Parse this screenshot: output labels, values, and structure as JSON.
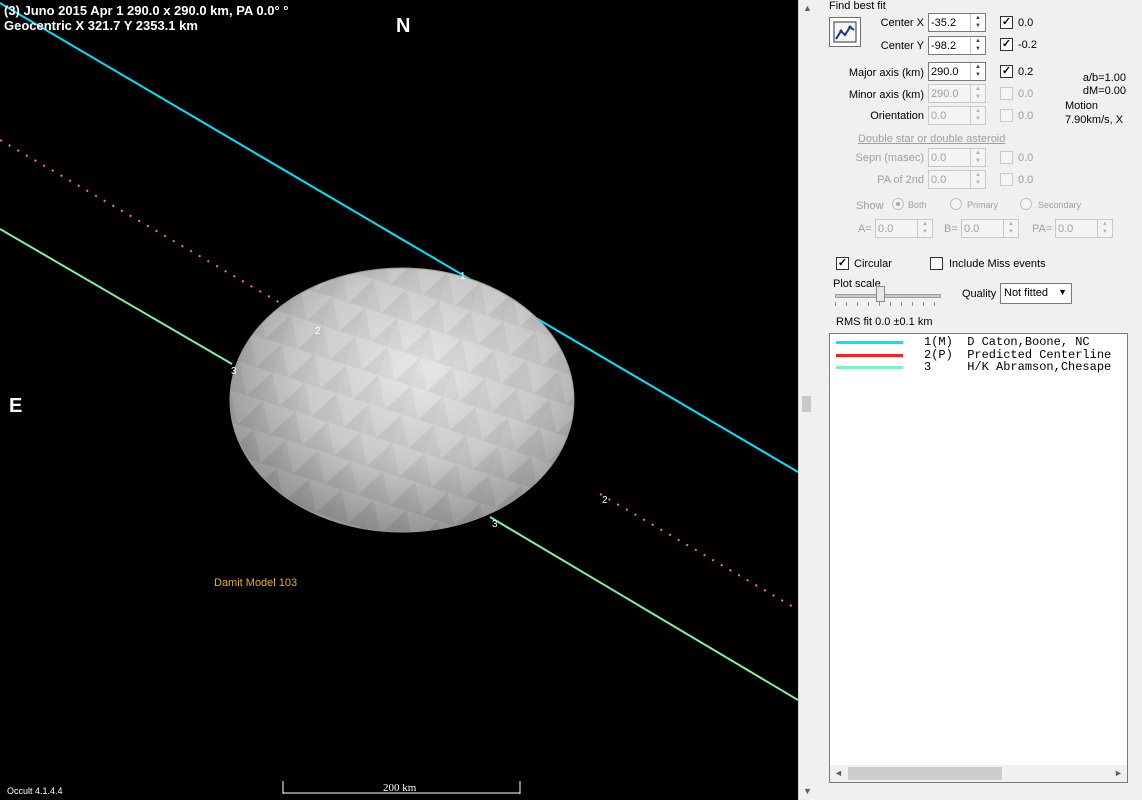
{
  "plot": {
    "title_line1": "(3) Juno  2015 Apr 1   290.0 x 290.0 km, PA 0.0° °",
    "title_line2": "Geocentric  X  321.7  Y 2353.1 km",
    "north": "N",
    "east": "E",
    "model_label": "Damit Model 103",
    "version": "Occult 4.1.4.4",
    "scale_label": "200 km",
    "chord_labels": [
      "1",
      "2",
      "3",
      "3",
      "2"
    ],
    "colors": {
      "background": "#000000",
      "chord1": "#00e5ff",
      "chord2": "#ff6070",
      "chord3": "#80f0a0",
      "model_label": "#e8b020"
    }
  },
  "panel": {
    "find_best_fit": "Find best fit",
    "fit_icon": "fit-chart-icon",
    "center_x": {
      "label": "Center X",
      "value": "-35.2",
      "checked": true,
      "delta": "0.0"
    },
    "center_y": {
      "label": "Center Y",
      "value": "-98.2",
      "checked": true,
      "delta": "-0.2"
    },
    "major_axis": {
      "label": "Major axis (km)",
      "value": "290.0",
      "checked": true,
      "delta": "0.2"
    },
    "minor_axis": {
      "label": "Minor axis (km)",
      "value": "290.0",
      "checked": false,
      "delta": "0.0"
    },
    "orientation": {
      "label": "Orientation",
      "value": "0.0",
      "checked": false,
      "delta": "0.0"
    },
    "ab_ratio": "a/b=1.00",
    "dm": "dM=0.00",
    "motion_label": "Motion",
    "motion_value": "7.90km/s, X",
    "double_star_link": "Double star  or  double asteroid",
    "sepn": {
      "label": "Sepn (masec)",
      "value": "0.0",
      "delta": "0.0"
    },
    "pa_2nd": {
      "label": "PA of 2nd",
      "value": "0.0",
      "delta": "0.0"
    },
    "show_label": "Show",
    "show_options": [
      "Both",
      "Primary",
      "Secondary"
    ],
    "a_label": "A=",
    "a_value": "0.0",
    "b_label": "B=",
    "b_value": "0.0",
    "pa_label": "PA=",
    "pa_value": "0.0",
    "circular_label": "Circular",
    "circular_checked": true,
    "include_miss_label": "Include Miss events",
    "include_miss_checked": false,
    "plot_scale_label": "Plot scale",
    "plot_scale_level": 0.4,
    "quality_label": "Quality",
    "quality_value": "Not fitted",
    "rms_fit": "RMS fit  0.0 ±0.1 km"
  },
  "legend": [
    {
      "text": "1(M)  D Caton,Boone, NC",
      "color": "#00e5ff"
    },
    {
      "text": "2(P)  Predicted Centerline",
      "color": "#ff2020"
    },
    {
      "text": "3     H/K Abramson,Chesape",
      "color": "#80f0c0"
    }
  ]
}
